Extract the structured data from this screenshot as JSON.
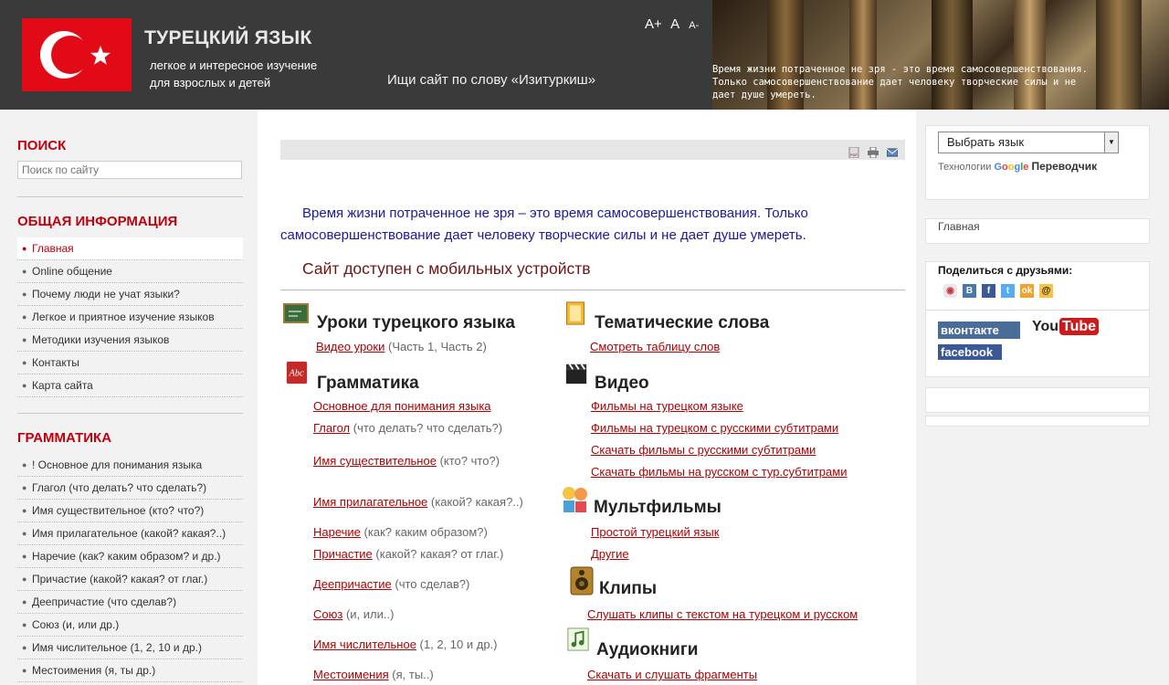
{
  "header": {
    "title": "ТУРЕЦКИЙ ЯЗЫК",
    "subtitle_line1": "легкое и интересное изучение",
    "subtitle_line2": "для взрослых и детей",
    "font_controls": [
      "A+",
      "A",
      "A-"
    ],
    "search_tagline": "Ищи сайт по слову «Изитуркиш»",
    "quote_overlay_line1": "Время жизни потраченное не зря - это время самосовершенствования.",
    "quote_overlay_line2": "Только самосовершенствование дает человеку творческие силы и не",
    "quote_overlay_line3": "дает душе умереть.",
    "flag_color": "#e30a17"
  },
  "left": {
    "search_heading": "ПОИСК",
    "search_placeholder": "Поиск по сайту",
    "general_heading": "ОБЩАЯ ИНФОРМАЦИЯ",
    "general_items": [
      "Главная",
      "Online общение",
      "Почему люди не учат языки?",
      "Легкое и приятное изучение языков",
      "Методики изучения языков",
      "Контакты",
      "Карта сайта"
    ],
    "grammar_heading": "ГРАММАТИКА",
    "grammar_items": [
      "! Основное для понимания языка",
      "Глагол (что делать? что сделать?)",
      "Имя существительное (кто? что?)",
      "Имя прилагательное (какой? какая?..)",
      "Наречие (как? каким образом? и др.)",
      "Причастие (какой? какая? от глаг.)",
      "Деепричастие (что сделав?)",
      "Союз (и, или др.)",
      "Имя числительное (1, 2, 10 и др.)",
      "Местоимения (я, ты др.)"
    ]
  },
  "main": {
    "intro": "Время жизни потраченное не зря – это время самосовершенствования. Только самосовершенствование дает человеку творческие силы и не дает душе умереть.",
    "mobile_note": "Сайт доступен с мобильных устройств",
    "lessons": {
      "title": "Уроки турецкого языка",
      "link": "Видео уроки",
      "note": "(Часть 1, Часть 2)"
    },
    "grammar": {
      "title": "Грамматика",
      "links": [
        {
          "text": "Основное для понимания языка",
          "note": ""
        },
        {
          "text": "Глагол",
          "note": "(что делать? что сделать?)"
        },
        {
          "text": "Имя существительное",
          "note": "(кто? что?)"
        },
        {
          "text": "Имя прилагательное",
          "note": "(какой? какая?..)"
        },
        {
          "text": "Наречие",
          "note": "(как? каким образом?)"
        },
        {
          "text": "Причастие",
          "note": "(какой? какая? от глаг.)"
        },
        {
          "text": "Деепричастие",
          "note": "(что сделав?)"
        },
        {
          "text": "Союз",
          "note": "(и, или..)"
        },
        {
          "text": "Имя числительное",
          "note": "(1, 2, 10 и др.)"
        },
        {
          "text": "Местоимения",
          "note": "(я, ты..)"
        }
      ]
    },
    "thematic": {
      "title": "Тематические слова",
      "link": "Смотреть таблицу слов"
    },
    "video": {
      "title": "Видео",
      "links": [
        "Фильмы на турецком языке",
        "Фильмы на турецком с русскими субтитрами",
        "Скачать фильмы с русскими субтитрами",
        "Скачать фильмы на русском с тур.субтитрами"
      ]
    },
    "cartoons": {
      "title": "Мультфильмы",
      "links": [
        "Простой турецкий язык",
        "Другие"
      ]
    },
    "clips": {
      "title": "Клипы",
      "link": "Слушать клипы с текстом на турецком и русском"
    },
    "audiobooks": {
      "title": "Аудиокниги",
      "link": "Скачать и слушать фрагменты"
    }
  },
  "right": {
    "language_select": "Выбрать язык",
    "powered_prefix": "Технологии",
    "powered_google": "Google",
    "powered_translate": "Переводчик",
    "home_link": "Главная",
    "share_heading": "Поделиться с друзьями:",
    "vk_label": "вконтакте",
    "youtube_you": "You",
    "youtube_tube": "Tube",
    "facebook_label": "facebook"
  },
  "colors": {
    "accent_red": "#c0000c",
    "link_red": "#b00000",
    "intro_blue": "#1a1a99",
    "header_bg": "#3a3a3a"
  }
}
